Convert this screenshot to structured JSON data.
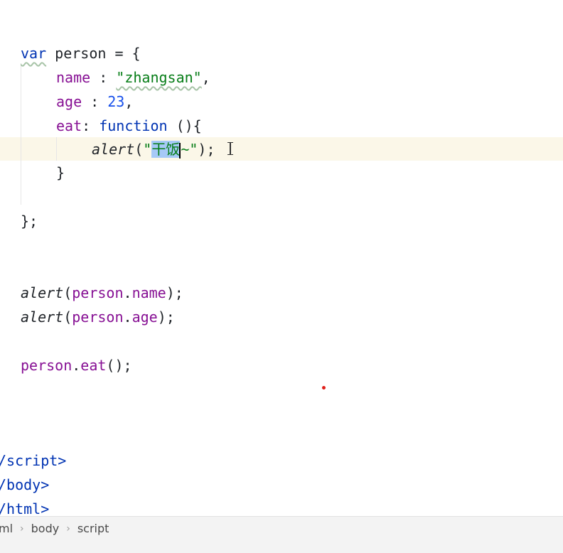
{
  "code": {
    "l1": {
      "kw": "var",
      "rest": " person = {"
    },
    "l2": {
      "prop": "name",
      "sep": " : ",
      "str": "\"zhangsan\"",
      "end": ","
    },
    "l3": {
      "prop": "age",
      "sep": " : ",
      "num": "23",
      "end": ","
    },
    "l4": {
      "prop": "eat",
      "sep": ": ",
      "kw": "function",
      "end": " (){"
    },
    "l5": {
      "fn": "alert",
      "open": "(",
      "str_open": "\"",
      "selected": "干饭",
      "str_close": "~\"",
      "end": ");"
    },
    "l6": {
      "text": "}"
    },
    "l7": {
      "text": "};"
    },
    "l8": {
      "fn": "alert",
      "open": "(",
      "obj": "person",
      "dot": ".",
      "prop": "name",
      "end": ");"
    },
    "l9": {
      "fn": "alert",
      "open": "(",
      "obj": "person",
      "dot": ".",
      "prop": "age",
      "end": ");"
    },
    "l10": {
      "obj": "person",
      "dot": ".",
      "prop": "eat",
      "end": "();"
    },
    "l11": {
      "text": "/script>"
    },
    "l12": {
      "text": "/body>"
    },
    "l13": {
      "text": "/html>"
    }
  },
  "breadcrumbs": {
    "item1": "ml",
    "item2": "body",
    "item3": "script",
    "separator": "›"
  },
  "colors": {
    "keyword": "#0033b3",
    "property": "#871094",
    "string": "#067d17",
    "number": "#1750eb",
    "selection": "#a6c9f7",
    "current_line": "#fbf7e8"
  }
}
